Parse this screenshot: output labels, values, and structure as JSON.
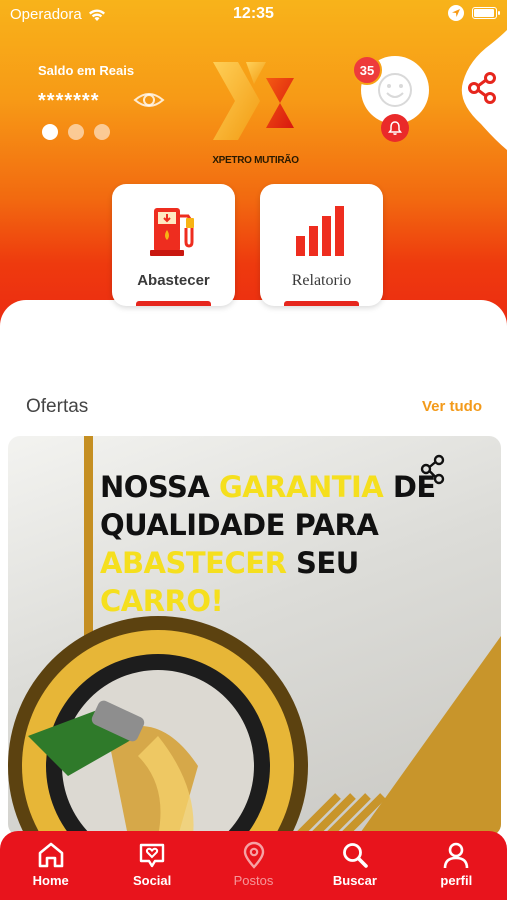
{
  "status_bar": {
    "carrier": "Operadora",
    "time": "12:35"
  },
  "header": {
    "balance_label": "Saldo em Reais",
    "balance_masked": "*******",
    "carousel_dots": 3,
    "active_dot": 0,
    "logo_text": "XPETRO MUTIRÃO",
    "notification_count": "35",
    "colors": {
      "gradient_top": "#f8b31a",
      "gradient_bottom": "#ec2a12",
      "accent_red": "#e6261d"
    }
  },
  "actions": [
    {
      "label": "Abastecer",
      "icon": "fuel-pump-icon"
    },
    {
      "label": "Relatorio",
      "icon": "bar-chart-icon"
    }
  ],
  "offers": {
    "title": "Ofertas",
    "see_all": "Ver tudo",
    "banner": {
      "line1_a": "NOSSA ",
      "line1_b": "GARANTIA",
      "line1_c": " DE",
      "line2": "QUALIDADE PARA",
      "line3_a": "ABASTECER",
      "line3_b": " SEU ",
      "line3_c": "CARRO!"
    }
  },
  "bottom_nav": [
    {
      "label": "Home",
      "icon": "home-icon",
      "active": true
    },
    {
      "label": "Social",
      "icon": "social-heart-icon",
      "active": false
    },
    {
      "label": "Postos",
      "icon": "location-pin-icon",
      "active": false
    },
    {
      "label": "Buscar",
      "icon": "search-icon",
      "active": false
    },
    {
      "label": "perfil",
      "icon": "user-icon",
      "active": false
    }
  ]
}
